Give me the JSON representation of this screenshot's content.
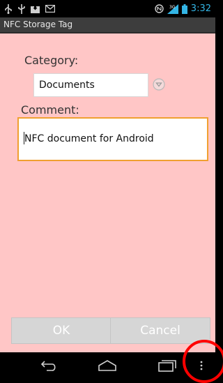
{
  "status_bar": {
    "time": "3:32",
    "icons": [
      "usb-icon",
      "usb-debug-icon",
      "download-icon",
      "mail-icon",
      "nfc-icon",
      "signal-icon",
      "battery-icon"
    ]
  },
  "app": {
    "title": "NFC Storage Tag"
  },
  "form": {
    "category_label": "Category:",
    "category_value": "Documents",
    "comment_label": "Comment:",
    "comment_value": "NFC document for Android"
  },
  "buttons": {
    "ok": "OK",
    "cancel": "Cancel"
  },
  "nav_bar": {
    "buttons": [
      "back",
      "home",
      "recent-apps",
      "menu"
    ]
  },
  "colors": {
    "background": "#ffc6c6",
    "focus_border": "#f0a030",
    "clock": "#33b5e5",
    "highlight": "#ff0000"
  }
}
